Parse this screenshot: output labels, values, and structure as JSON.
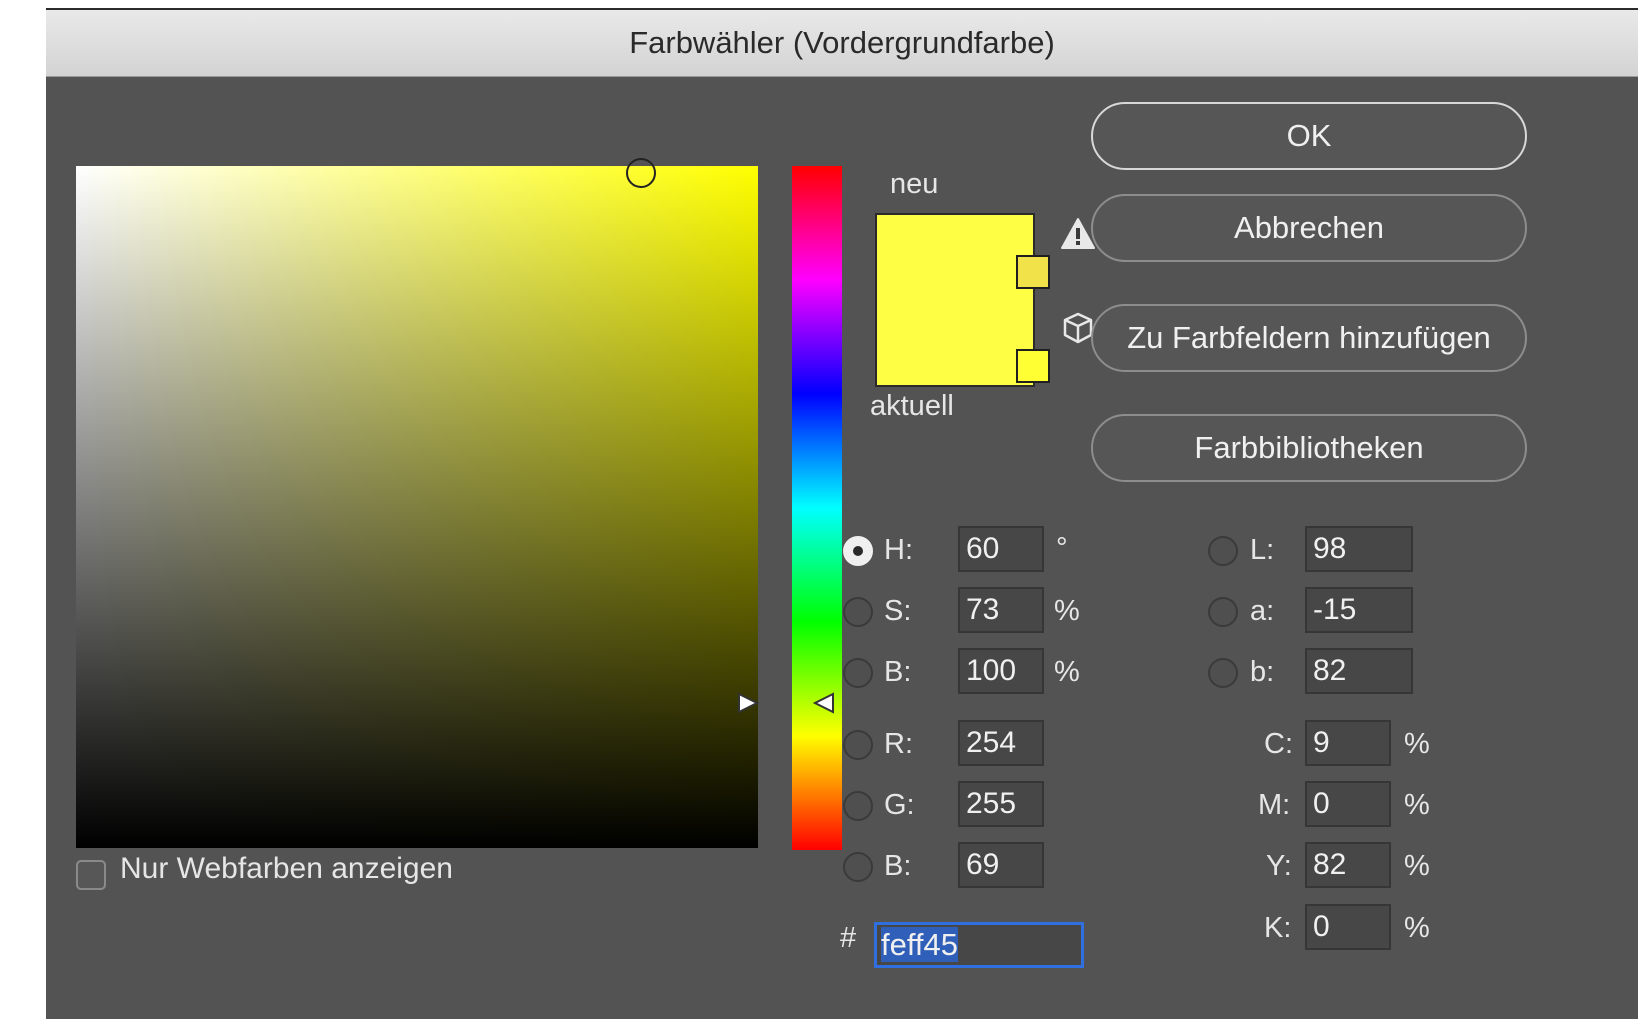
{
  "window": {
    "title": "Farbwähler (Vordergrundfarbe)"
  },
  "colors": {
    "new": "#feff45",
    "current": "#feff45",
    "gamut_warning_swatch": "#f2e24a",
    "web_safe_swatch": "#ffff33"
  },
  "preview": {
    "new_label": "neu",
    "current_label": "aktuell"
  },
  "icons": {
    "gamut_warning": "warning-triangle-icon",
    "web_safe": "cube-icon"
  },
  "buttons": {
    "ok": "OK",
    "cancel": "Abbrechen",
    "add_to_swatches": "Zu Farbfeldern hinzufügen",
    "color_libraries": "Farbbibliotheken"
  },
  "web_colors_only": {
    "label": "Nur Webfarben anzeigen",
    "checked": false
  },
  "hsb": {
    "h": {
      "label": "H:",
      "value": "60",
      "unit": "°",
      "selected": true
    },
    "s": {
      "label": "S:",
      "value": "73",
      "unit": "%",
      "selected": false
    },
    "b": {
      "label": "B:",
      "value": "100",
      "unit": "%",
      "selected": false
    }
  },
  "rgb": {
    "r": {
      "label": "R:",
      "value": "254"
    },
    "g": {
      "label": "G:",
      "value": "255"
    },
    "b": {
      "label": "B:",
      "value": "69"
    }
  },
  "lab": {
    "l": {
      "label": "L:",
      "value": "98"
    },
    "a": {
      "label": "a:",
      "value": "-15"
    },
    "b": {
      "label": "b:",
      "value": "82"
    }
  },
  "cmyk": {
    "c": {
      "label": "C:",
      "value": "9",
      "unit": "%"
    },
    "m": {
      "label": "M:",
      "value": "0",
      "unit": "%"
    },
    "y": {
      "label": "Y:",
      "value": "82",
      "unit": "%"
    },
    "k": {
      "label": "K:",
      "value": "0",
      "unit": "%"
    }
  },
  "hex": {
    "label": "#",
    "value": "feff45"
  }
}
